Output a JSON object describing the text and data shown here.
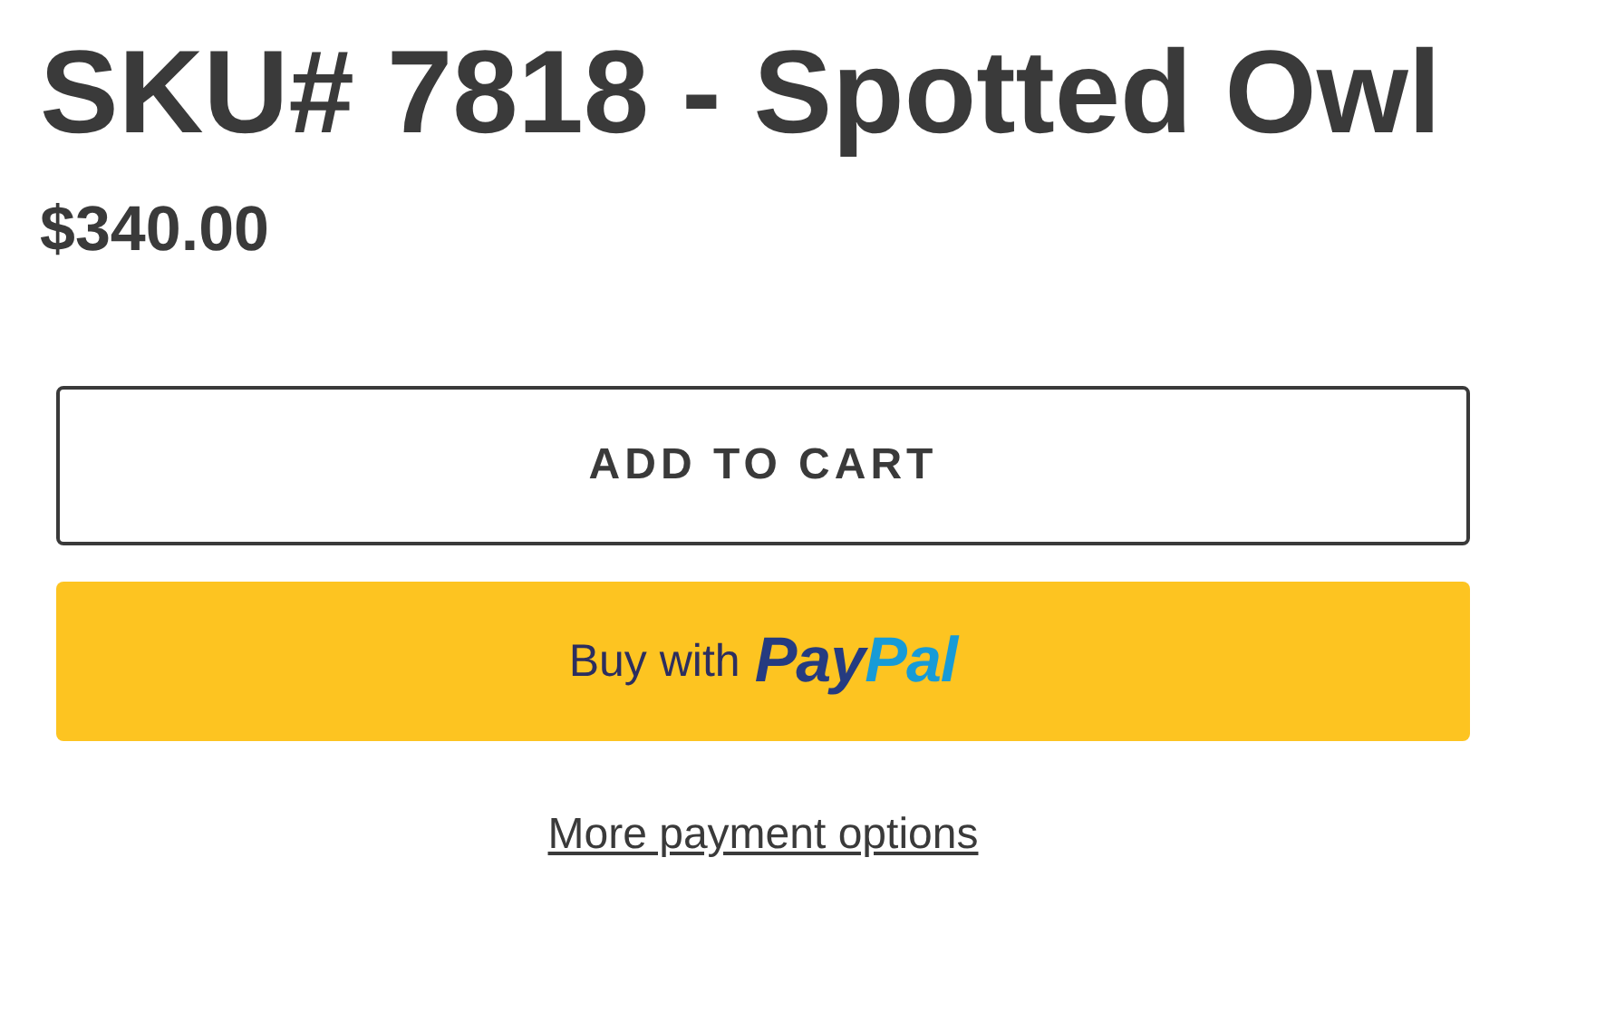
{
  "product": {
    "title": "SKU# 7818 - Spotted Owl",
    "price": "$340.00"
  },
  "add_to_cart": {
    "label": "ADD TO CART"
  },
  "paypal_button": {
    "label": "Buy with",
    "logo_parts": [
      {
        "text": "Pay",
        "color": "#253b80"
      },
      {
        "text": "Pal",
        "color": "#179bd7"
      }
    ]
  },
  "more_options": {
    "label": "More payment options"
  }
}
